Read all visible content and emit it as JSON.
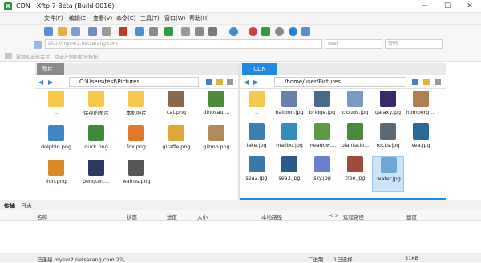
{
  "window": {
    "title": "CDN - Xftp 7 Beta (Build 0016)",
    "app_icon": "xftp-logo-icon",
    "controls": {
      "minimize": "─",
      "maximize": "☐",
      "close": "✕"
    }
  },
  "menu": [
    "文件(F)",
    "编辑(E)",
    "查看(V)",
    "命令(C)",
    "工具(T)",
    "窗口(W)",
    "帮助(H)"
  ],
  "address": {
    "host_placeholder": "sftp://mysvr2.netsarang.com",
    "user_placeholder": "user",
    "password_placeholder": "密码"
  },
  "hint": "要添加当前会话，点击左侧的箭头按钮。",
  "left": {
    "tab_label": "图片",
    "path": "C:\\Users\\test\\Pictures",
    "files": [
      {
        "name": "..",
        "kind": "folder"
      },
      {
        "name": "保存的图片",
        "kind": "folder"
      },
      {
        "name": "本机照片",
        "kind": "folder"
      },
      {
        "name": "cat.png",
        "kind": "image",
        "color": "#8a6a4e"
      },
      {
        "name": "dinosaur...",
        "kind": "image",
        "color": "#4f8a3c"
      },
      {
        "name": "dolphin.png",
        "kind": "image",
        "color": "#3f86c9"
      },
      {
        "name": "duck.png",
        "kind": "image",
        "color": "#3c8a3a"
      },
      {
        "name": "fox.png",
        "kind": "image",
        "color": "#e07a2a"
      },
      {
        "name": "giraffe.png",
        "kind": "image",
        "color": "#e0a537"
      },
      {
        "name": "gizmo.png",
        "kind": "image",
        "color": "#b08a5a"
      },
      {
        "name": "lion.png",
        "kind": "image",
        "color": "#d98a26"
      },
      {
        "name": "penguin....",
        "kind": "image",
        "color": "#2a3b5f"
      },
      {
        "name": "walrus.png",
        "kind": "image",
        "color": "#555555"
      }
    ]
  },
  "right": {
    "tab_label": "CDN",
    "path": "/home/user/Pictures",
    "files": [
      {
        "name": "..",
        "kind": "folder"
      },
      {
        "name": "balloon.jpg",
        "kind": "image",
        "color": "#6a7fb0"
      },
      {
        "name": "bridge.jpg",
        "kind": "image",
        "color": "#4a6a8a"
      },
      {
        "name": "clouds.jpg",
        "kind": "image",
        "color": "#7a9ac4"
      },
      {
        "name": "galaxy.jpg",
        "kind": "image",
        "color": "#3a2a6a"
      },
      {
        "name": "homberg....",
        "kind": "image",
        "color": "#b08050"
      },
      {
        "name": "lake.jpg",
        "kind": "image",
        "color": "#3f7fb0"
      },
      {
        "name": "malibu.jpg",
        "kind": "image",
        "color": "#2f8fb8"
      },
      {
        "name": "meadow....",
        "kind": "image",
        "color": "#5a9a40"
      },
      {
        "name": "plantatio...",
        "kind": "image",
        "color": "#4a8a3a"
      },
      {
        "name": "rocks.jpg",
        "kind": "image",
        "color": "#5a6a70"
      },
      {
        "name": "sea.jpg",
        "kind": "image",
        "color": "#2a6a9a"
      },
      {
        "name": "sea2.jpg",
        "kind": "image",
        "color": "#3a78a8"
      },
      {
        "name": "sea3.jpg",
        "kind": "image",
        "color": "#2a5a8a"
      },
      {
        "name": "sky.jpg",
        "kind": "image",
        "color": "#6a7fd0"
      },
      {
        "name": "tree.jpg",
        "kind": "image",
        "color": "#a04a3a"
      },
      {
        "name": "water.jpg",
        "kind": "image",
        "color": "#6aa8d8",
        "selected": true
      }
    ]
  },
  "bottom": {
    "tabs": [
      "传输",
      "日志"
    ],
    "columns": [
      "名称",
      "状态",
      "进度",
      "大小",
      "本地路径",
      "<->",
      "远程路径",
      "速度"
    ]
  },
  "status": {
    "connection": "已连接 mysvr2.netsarang.com:22。",
    "mode": "二进制",
    "selection": "1已选择",
    "size": "31KB"
  },
  "colors": {
    "accent": "#1e8ae6",
    "selection": "#cce4f7",
    "folder": "#f6c84c"
  }
}
